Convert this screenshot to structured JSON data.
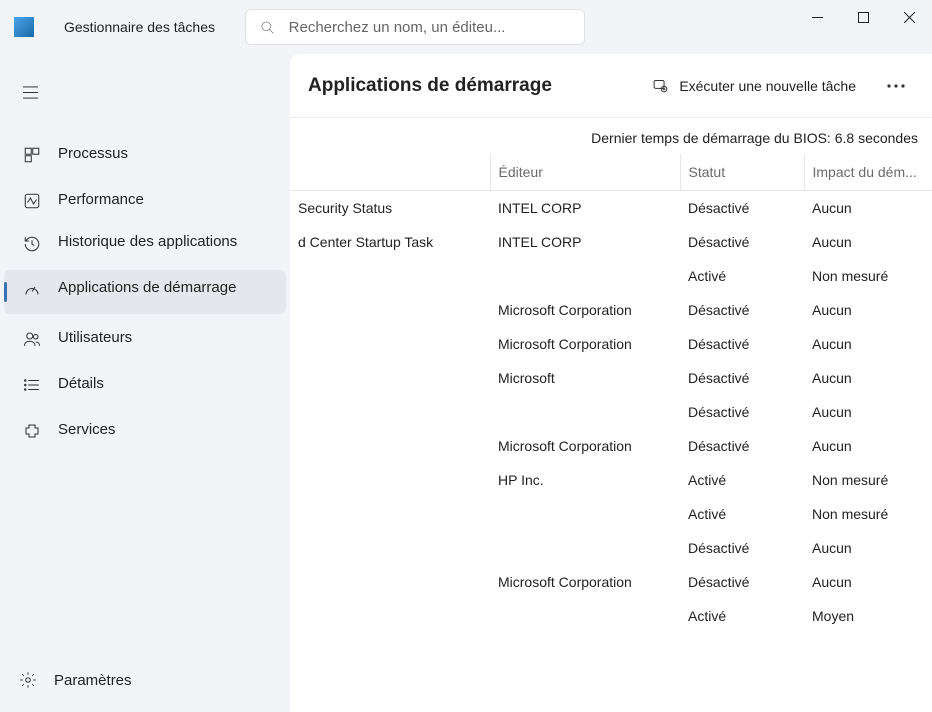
{
  "app": {
    "title": "Gestionnaire des tâches"
  },
  "search": {
    "placeholder": "Recherchez un nom, un éditeu..."
  },
  "sidebar": {
    "items": [
      {
        "label": "Processus"
      },
      {
        "label": "Performance"
      },
      {
        "label": "Historique des applications"
      },
      {
        "label": "Applications de démarrage"
      },
      {
        "label": "Utilisateurs"
      },
      {
        "label": "Détails"
      },
      {
        "label": "Services"
      }
    ],
    "settings_label": "Paramètres"
  },
  "main": {
    "title": "Applications de démarrage",
    "run_task_label": "Exécuter une nouvelle tâche",
    "bios_line": "Dernier temps de démarrage du BIOS: 6.8 secondes",
    "columns": {
      "name": "",
      "publisher": "Éditeur",
      "status": "Statut",
      "impact": "Impact du dém..."
    },
    "rows": [
      {
        "name": "Security Status",
        "publisher": "INTEL CORP",
        "status": "Désactivé",
        "impact": "Aucun"
      },
      {
        "name": "d Center Startup Task",
        "publisher": "INTEL CORP",
        "status": "Désactivé",
        "impact": "Aucun"
      },
      {
        "name": "",
        "publisher": "",
        "status": "Activé",
        "impact": "Non mesuré"
      },
      {
        "name": "",
        "publisher": "Microsoft Corporation",
        "status": "Désactivé",
        "impact": "Aucun"
      },
      {
        "name": "",
        "publisher": "Microsoft Corporation",
        "status": "Désactivé",
        "impact": "Aucun"
      },
      {
        "name": "",
        "publisher": "Microsoft",
        "status": "Désactivé",
        "impact": "Aucun"
      },
      {
        "name": "",
        "publisher": "",
        "status": "Désactivé",
        "impact": "Aucun"
      },
      {
        "name": "",
        "publisher": "Microsoft Corporation",
        "status": "Désactivé",
        "impact": "Aucun"
      },
      {
        "name": "",
        "publisher": "HP Inc.",
        "status": "Activé",
        "impact": "Non mesuré"
      },
      {
        "name": "",
        "publisher": "",
        "status": "Activé",
        "impact": "Non mesuré"
      },
      {
        "name": "",
        "publisher": "",
        "status": "Désactivé",
        "impact": "Aucun"
      },
      {
        "name": "",
        "publisher": "Microsoft Corporation",
        "status": "Désactivé",
        "impact": "Aucun"
      },
      {
        "name": "",
        "publisher": "",
        "status": "Activé",
        "impact": "Moyen"
      }
    ]
  }
}
